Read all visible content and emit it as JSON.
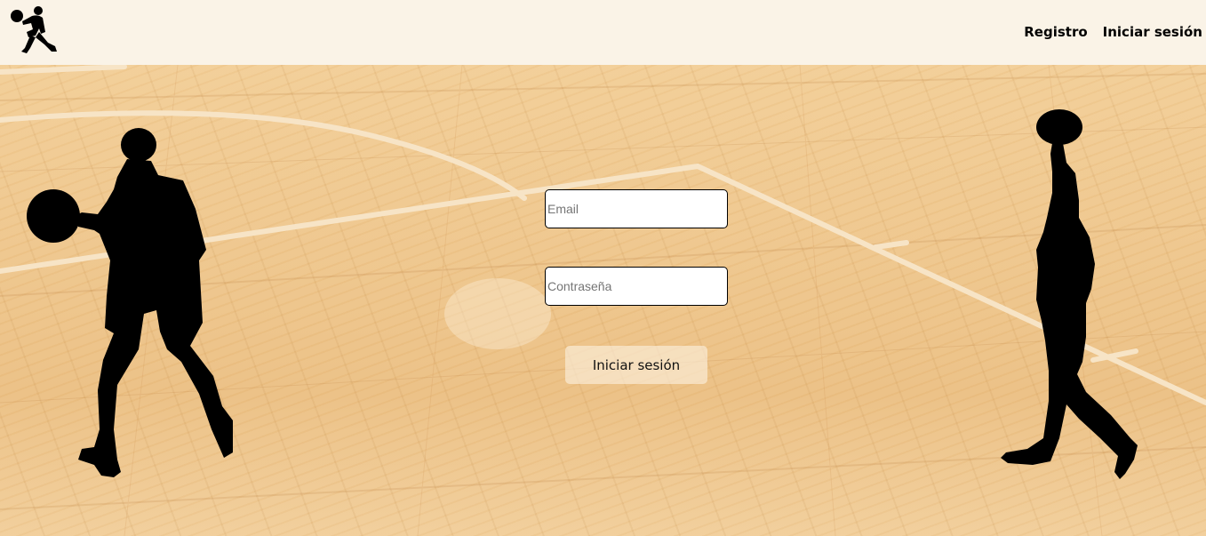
{
  "header": {
    "logo_icon": "basketball-player-logo-icon",
    "nav": {
      "register_label": "Registro",
      "login_label": "Iniciar sesión"
    }
  },
  "login_form": {
    "email": {
      "placeholder": "Email",
      "value": ""
    },
    "password": {
      "placeholder": "Contraseña",
      "value": ""
    },
    "submit_label": "Iniciar sesión"
  },
  "background": {
    "icon": "basketball-court-floor",
    "left_figure_icon": "basketball-player-dribbling-icon",
    "right_figure_icon": "basketball-player-dunking-icon"
  },
  "colors": {
    "header_bg": "#faf3e7",
    "floor": "#eec58a",
    "court_lines": "#f7e4c6",
    "silhouette": "#000000"
  }
}
